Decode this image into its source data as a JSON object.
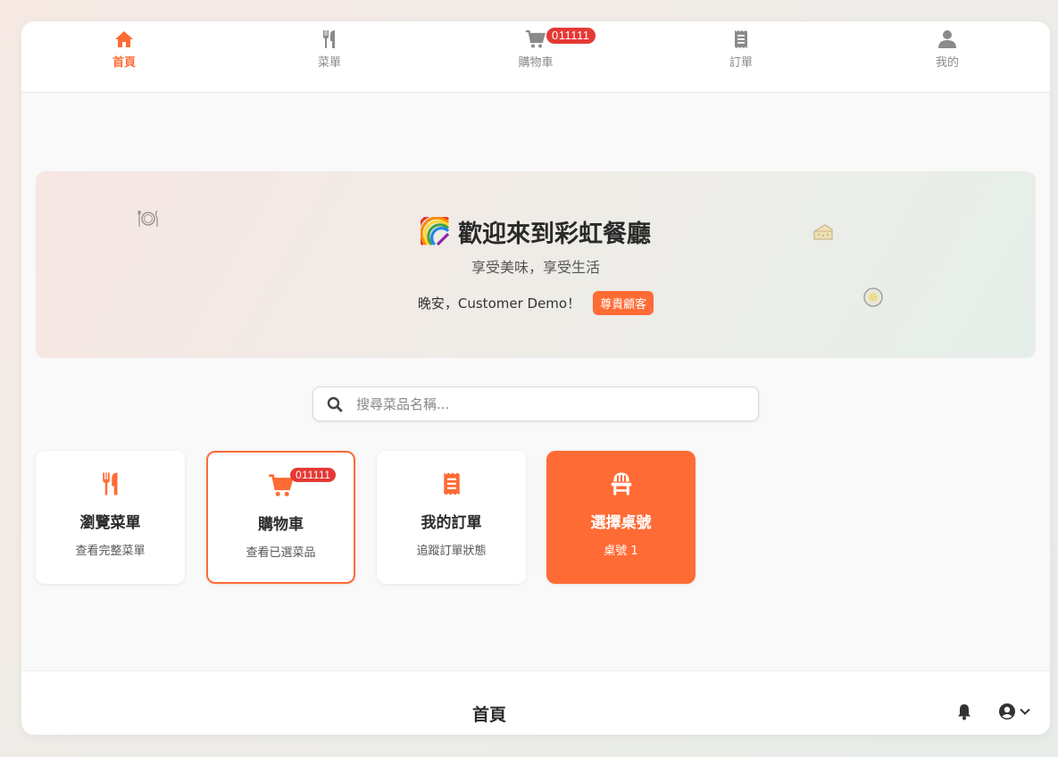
{
  "nav": {
    "items": [
      {
        "label": "首頁",
        "icon": "home-icon",
        "active": true
      },
      {
        "label": "菜單",
        "icon": "utensils-icon"
      },
      {
        "label": "購物車",
        "icon": "cart-icon",
        "badge": "011111"
      },
      {
        "label": "訂單",
        "icon": "receipt-icon"
      },
      {
        "label": "我的",
        "icon": "user-icon"
      }
    ]
  },
  "hero": {
    "title": "歡迎來到彩虹餐廳",
    "subtitle": "享受美味，享受生活",
    "greeting": "晚安，Customer Demo！",
    "vip_badge": "尊貴顧客"
  },
  "search": {
    "placeholder": "搜尋菜品名稱..."
  },
  "cards": [
    {
      "title": "瀏覽菜單",
      "desc": "查看完整菜單",
      "icon": "utensils-icon"
    },
    {
      "title": "購物車",
      "desc": "查看已選菜品",
      "icon": "cart-icon",
      "badge": "011111"
    },
    {
      "title": "我的訂單",
      "desc": "追蹤訂單狀態",
      "icon": "receipt-icon"
    },
    {
      "title": "選擇桌號",
      "desc": "桌號 1",
      "icon": "chair-icon"
    }
  ],
  "bottom": {
    "title": "首頁"
  },
  "colors": {
    "accent": "#ff6b35",
    "badge": "#e53935",
    "nav_inactive": "#8a8a8a"
  }
}
